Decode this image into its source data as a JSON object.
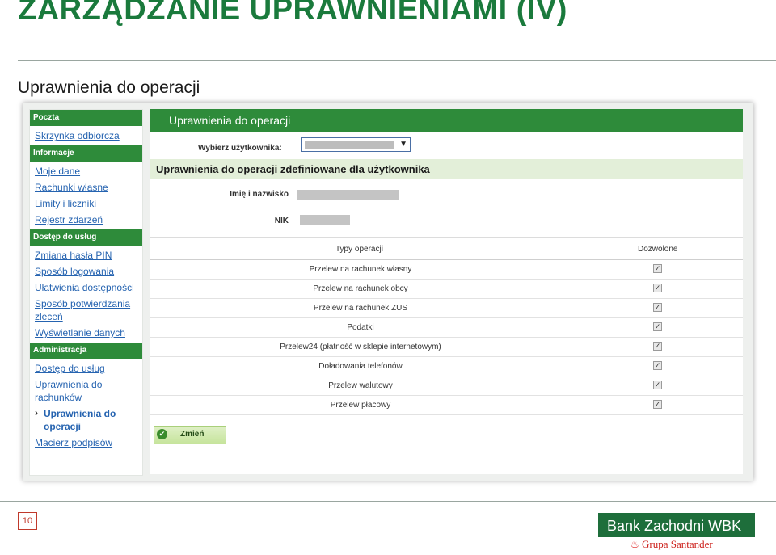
{
  "slide": {
    "title": "ZARZĄDZANIE UPRAWNIENIAMI (IV)",
    "subtitle": "Uprawnienia do operacji",
    "page_number": "10"
  },
  "sidebar": {
    "sections": [
      {
        "header": "Poczta",
        "links": [
          {
            "label": "Skrzynka odbiorcza"
          }
        ]
      },
      {
        "header": "Informacje",
        "links": [
          {
            "label": "Moje dane"
          },
          {
            "label": "Rachunki własne"
          },
          {
            "label": "Limity i liczniki"
          },
          {
            "label": "Rejestr zdarzeń"
          }
        ]
      },
      {
        "header": "Dostęp do usług",
        "links": [
          {
            "label": "Zmiana hasła PIN"
          },
          {
            "label": "Sposób logowania"
          },
          {
            "label": "Ułatwienia dostępności"
          },
          {
            "label": "Sposób potwierdzania zleceń"
          },
          {
            "label": "Wyświetlanie danych"
          }
        ]
      },
      {
        "header": "Administracja",
        "links": [
          {
            "label": "Dostęp do usług"
          },
          {
            "label": "Uprawnienia do rachunków"
          },
          {
            "label": "Uprawnienia do operacji",
            "active": true
          },
          {
            "label": "Macierz podpisów"
          }
        ]
      }
    ]
  },
  "main": {
    "header": "Uprawnienia do operacji",
    "user_select_label": "Wybierz użytkownika:",
    "band_title": "Uprawnienia do operacji zdefiniowane dla użytkownika",
    "name_label": "Imię i nazwisko",
    "nik_label": "NIK",
    "table": {
      "col_type": "Typy operacji",
      "col_allowed": "Dozwolone",
      "rows": [
        {
          "op": "Przelew na rachunek własny",
          "allowed": true
        },
        {
          "op": "Przelew na rachunek obcy",
          "allowed": true
        },
        {
          "op": "Przelew na rachunek ZUS",
          "allowed": true
        },
        {
          "op": "Podatki",
          "allowed": true
        },
        {
          "op": "Przelew24 (płatność w sklepie internetowym)",
          "allowed": true
        },
        {
          "op": "Doładowania telefonów",
          "allowed": true
        },
        {
          "op": "Przelew walutowy",
          "allowed": true
        },
        {
          "op": "Przelew płacowy",
          "allowed": true
        }
      ]
    },
    "change_button": "Zmień"
  },
  "logo": {
    "line1": "Bank Zachodni WBK",
    "line2": "Grupa Santander"
  },
  "colors": {
    "title_green": "#1a7a3c",
    "header_green": "#2e8b3a",
    "link_blue": "#2563b0",
    "band_green": "#e3efd9",
    "brand_red": "#cc1f1a"
  }
}
